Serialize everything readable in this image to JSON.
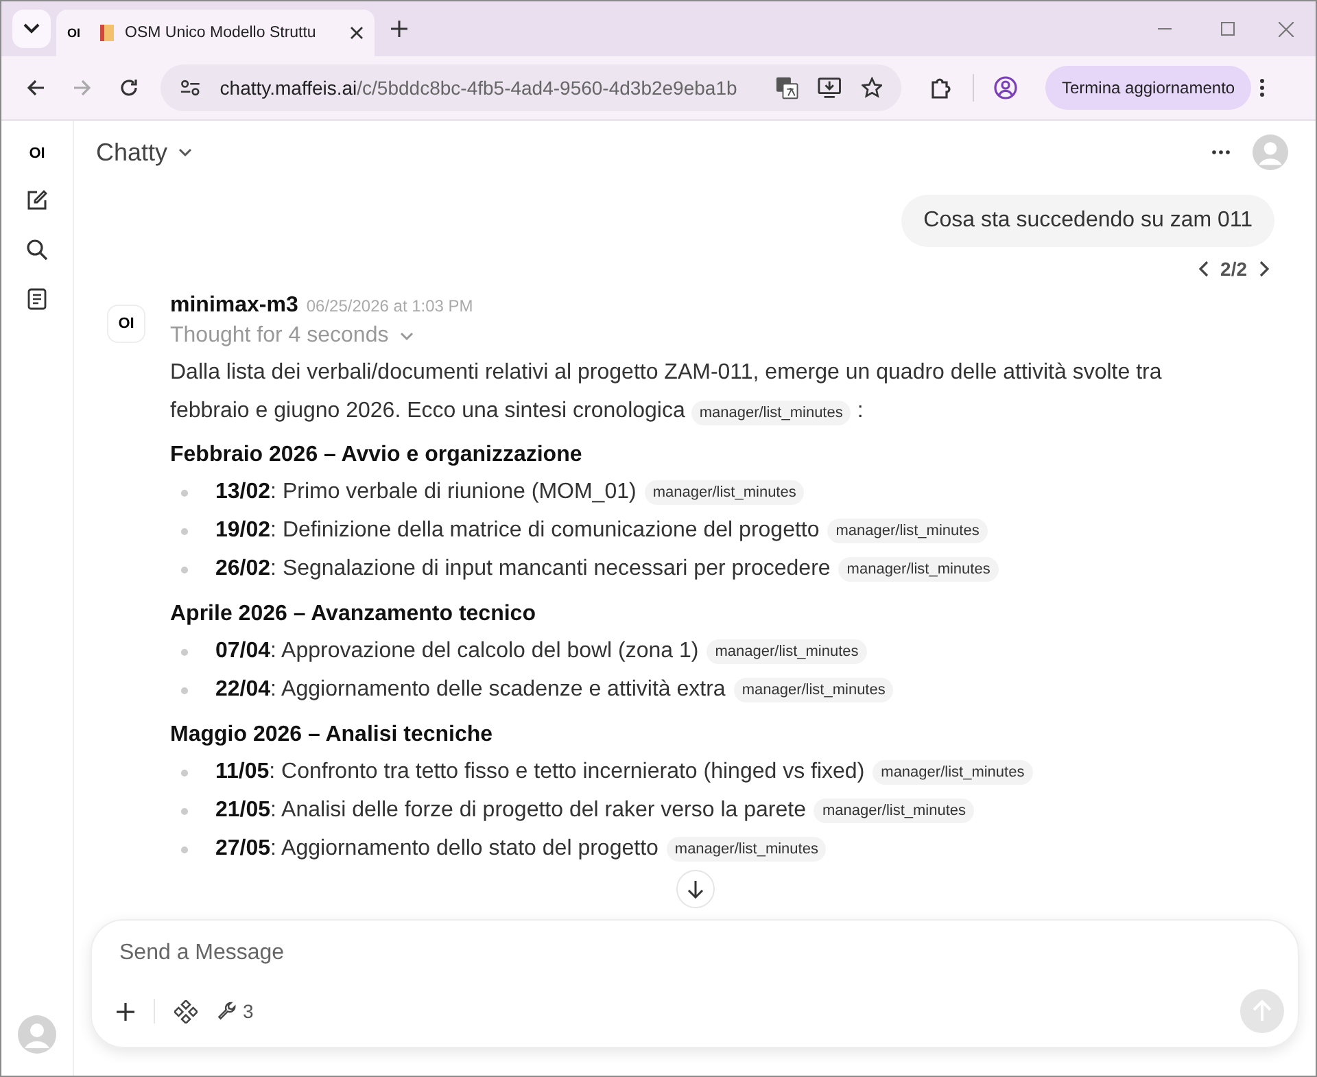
{
  "browser": {
    "tab": {
      "title": "OSM Unico Modello Struttu",
      "favicon_text": "OI"
    },
    "url": {
      "host": "chatty.maffeis.ai",
      "path": "/c/5bddc8bc-4fb5-4ad4-9560-4d3b2e9eba1b"
    },
    "update_button": "Termina aggiornamento"
  },
  "sidebar": {
    "logo": "OI"
  },
  "header": {
    "title": "Chatty"
  },
  "user_message": {
    "text": "Cosa sta succedendo su zam 011",
    "pager": "2/2"
  },
  "assistant": {
    "avatar": "OI",
    "model": "minimax-m3",
    "time": "06/25/2026 at 1:03 PM",
    "thought": "Thought for 4 seconds",
    "intro": {
      "text": "Dalla lista dei verbali/documenti relativi al progetto ZAM-011, emerge un quadro delle attività svolte tra febbraio e giugno 2026. Ecco una sintesi cronologica",
      "tool": "manager/list_minutes",
      "after": ":"
    },
    "sections": [
      {
        "heading": "Febbraio 2026 – Avvio e organizzazione",
        "items": [
          {
            "date": "13/02",
            "text": ": Primo verbale di riunione (MOM_01)",
            "tool": "manager/list_minutes"
          },
          {
            "date": "19/02",
            "text": ": Definizione della matrice di comunicazione del progetto",
            "tool": "manager/list_minutes"
          },
          {
            "date": "26/02",
            "text": ": Segnalazione di input mancanti necessari per procedere",
            "tool": "manager/list_minutes"
          }
        ]
      },
      {
        "heading": "Aprile 2026 – Avanzamento tecnico",
        "items": [
          {
            "date": "07/04",
            "text": ": Approvazione del calcolo del bowl (zona 1)",
            "tool": "manager/list_minutes"
          },
          {
            "date": "22/04",
            "text": ": Aggiornamento delle scadenze e attività extra",
            "tool": "manager/list_minutes"
          }
        ]
      },
      {
        "heading": "Maggio 2026 – Analisi tecniche",
        "items": [
          {
            "date": "11/05",
            "text": ": Confronto tra tetto fisso e tetto incernierato (hinged vs fixed)",
            "tool": "manager/list_minutes"
          },
          {
            "date": "21/05",
            "text": ": Analisi delle forze di progetto del raker verso la parete",
            "tool": "manager/list_minutes"
          },
          {
            "date": "27/05",
            "text": ": Aggiornamento dello stato del progetto",
            "tool": "manager/list_minutes"
          }
        ]
      }
    ]
  },
  "composer": {
    "placeholder": "Send a Message",
    "tools_count": "3"
  }
}
